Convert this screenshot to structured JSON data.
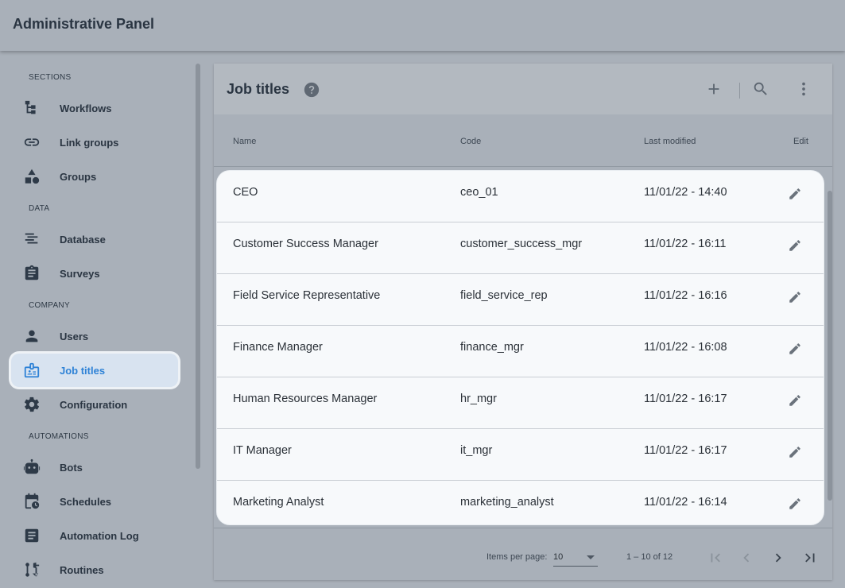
{
  "app": {
    "title": "Administrative Panel"
  },
  "sidebar": {
    "sections": [
      {
        "label": "SECTIONS"
      },
      {
        "label": "DATA"
      },
      {
        "label": "COMPANY"
      },
      {
        "label": "AUTOMATIONS"
      }
    ],
    "items": [
      {
        "label": "Workflows",
        "icon": "workflow-icon"
      },
      {
        "label": "Link groups",
        "icon": "link-icon"
      },
      {
        "label": "Groups",
        "icon": "shapes-icon"
      },
      {
        "label": "Database",
        "icon": "align-icon"
      },
      {
        "label": "Surveys",
        "icon": "clipboard-icon"
      },
      {
        "label": "Users",
        "icon": "person-icon"
      },
      {
        "label": "Job titles",
        "icon": "badge-icon",
        "active": true
      },
      {
        "label": "Configuration",
        "icon": "gear-icon"
      },
      {
        "label": "Bots",
        "icon": "robot-icon"
      },
      {
        "label": "Schedules",
        "icon": "calendar-clock-icon"
      },
      {
        "label": "Automation Log",
        "icon": "log-icon"
      },
      {
        "label": "Routines",
        "icon": "routine-icon"
      }
    ]
  },
  "panel": {
    "title": "Job titles",
    "columns": {
      "name": "Name",
      "code": "Code",
      "modified": "Last modified",
      "edit": "Edit"
    },
    "rows": [
      {
        "name": "CEO",
        "code": "ceo_01",
        "modified": "11/01/22 - 14:40"
      },
      {
        "name": "Customer Success Manager",
        "code": "customer_success_mgr",
        "modified": "11/01/22 - 16:11"
      },
      {
        "name": "Field Service Representative",
        "code": "field_service_rep",
        "modified": "11/01/22 - 16:16"
      },
      {
        "name": "Finance Manager",
        "code": "finance_mgr",
        "modified": "11/01/22 - 16:08"
      },
      {
        "name": "Human Resources Manager",
        "code": "hr_mgr",
        "modified": "11/01/22 - 16:17"
      },
      {
        "name": "IT Manager",
        "code": "it_mgr",
        "modified": "11/01/22 - 16:17"
      },
      {
        "name": "Marketing Analyst",
        "code": "marketing_analyst",
        "modified": "11/01/22 - 16:14"
      }
    ]
  },
  "pagination": {
    "items_per_page_label": "Items per page:",
    "page_size": "10",
    "range": "1 – 10 of 12"
  },
  "colors": {
    "accent": "#2e82d6",
    "active_bg": "#d8e3f0",
    "row_bg": "#f7f9fb"
  }
}
